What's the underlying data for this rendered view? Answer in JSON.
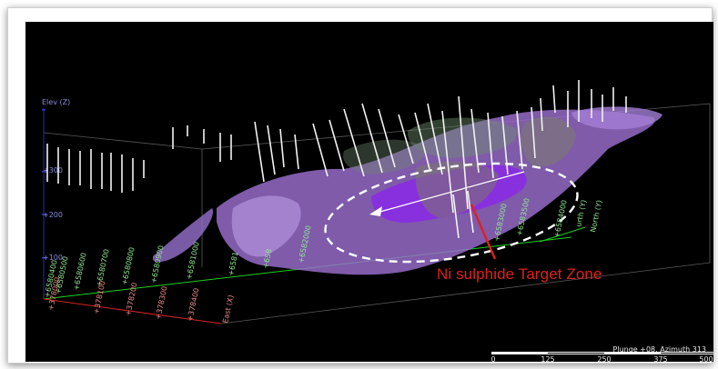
{
  "view": {
    "status": "Plunge +08, Azimuth 313",
    "annotation": "Ni sulphide Target Zone",
    "colors": {
      "background": "#000000",
      "body": "#9b6fd0",
      "core": "#8a2be2",
      "north_axis": "#1fd01f",
      "east_axis": "#d42424",
      "annotation": "#e0201c"
    }
  },
  "axes": {
    "elev_label": "Elev (Z)",
    "elev_ticks": [
      "+300",
      "+200",
      "+100"
    ],
    "north_label": "North (Y)",
    "north_label_far": "urth (Y)",
    "north_ticks": [
      "+6580400",
      "+6580500",
      "+6580600",
      "+6580700",
      "+6580800",
      "+6580900",
      "+6581000",
      "+6581",
      "+658",
      "+6582000"
    ],
    "north_far_ticks": [
      "+6583000",
      "+6583500",
      "+6584000"
    ],
    "east_label": "East (X)",
    "east_ticks": [
      "+378000",
      "+378100",
      "+378200",
      "+378300",
      "+378400"
    ]
  },
  "scale": {
    "ticks": [
      "0",
      "125",
      "250",
      "375",
      "500"
    ]
  }
}
